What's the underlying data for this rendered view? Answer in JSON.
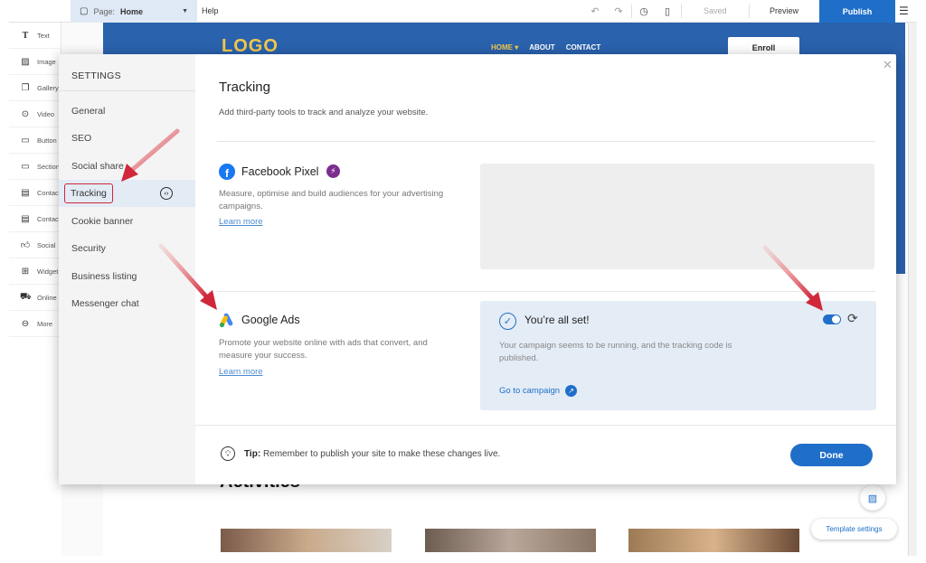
{
  "topbar": {
    "page_label": "Page:",
    "page_value": "Home",
    "help": "Help",
    "saved": "Saved",
    "preview": "Preview",
    "publish": "Publish"
  },
  "tools": [
    "Text",
    "Image",
    "Gallery",
    "Video",
    "Button",
    "Section",
    "Contact",
    "Contact",
    "Social",
    "Widget",
    "Online",
    "More"
  ],
  "site": {
    "logo": "LOGO",
    "nav": [
      "HOME",
      "ABOUT",
      "CONTACT"
    ],
    "enroll": "Enroll",
    "section_heading": "Activities",
    "template_settings": "Template settings"
  },
  "settings": {
    "title": "SETTINGS",
    "items": [
      "General",
      "SEO",
      "Social share",
      "Tracking",
      "Cookie banner",
      "Security",
      "Business listing",
      "Messenger chat"
    ],
    "active_item": "Tracking"
  },
  "tracking": {
    "title": "Tracking",
    "subtitle": "Add third-party tools to track and analyze your website.",
    "facebook": {
      "name": "Facebook Pixel",
      "desc": "Measure, optimise and build audiences for your advertising campaigns.",
      "learn_more": "Learn more"
    },
    "google": {
      "name": "Google Ads",
      "desc": "Promote your website online with ads that convert, and measure your success.",
      "learn_more": "Learn more",
      "status_title": "You’re all set!",
      "status_msg": "Your campaign seems to be running, and the tracking code is published.",
      "go_to": "Go to campaign",
      "enabled": true
    },
    "tip_label": "Tip:",
    "tip_text": "Remember to publish your site to make these changes live.",
    "done": "Done"
  },
  "colors": {
    "accent": "#1f6fc9",
    "hero": "#2a62ad",
    "annotation": "#d0273a",
    "facebook": "#1877f2"
  }
}
